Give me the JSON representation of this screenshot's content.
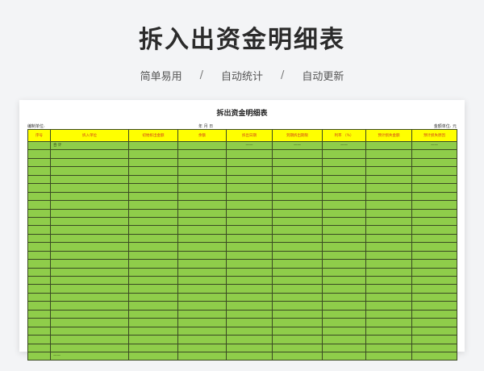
{
  "hero": {
    "title": "拆入出资金明细表",
    "tags": [
      "简单易用",
      "自动统计",
      "自动更新"
    ],
    "separator": "/"
  },
  "sheet": {
    "title": "拆出资金明细表",
    "org_label": "编制单位:",
    "date_label": "年  月  日",
    "unit_label": "金额单位: 元",
    "header_bg": "#ffff00",
    "header_text_color": "#d23a1a",
    "body_bg": "#8fcd4a",
    "columns": [
      "序号",
      "拆入单位",
      "初始拆出金额",
      "余额",
      "拆出日期",
      "到期拆出期限",
      "利率 （%）",
      "预计损失金额",
      "预计损失原因"
    ],
    "subtotal_row": {
      "label": "合    计",
      "dashes": [
        "——",
        "——",
        "——",
        "——"
      ]
    },
    "last_row_mark": "——"
  }
}
